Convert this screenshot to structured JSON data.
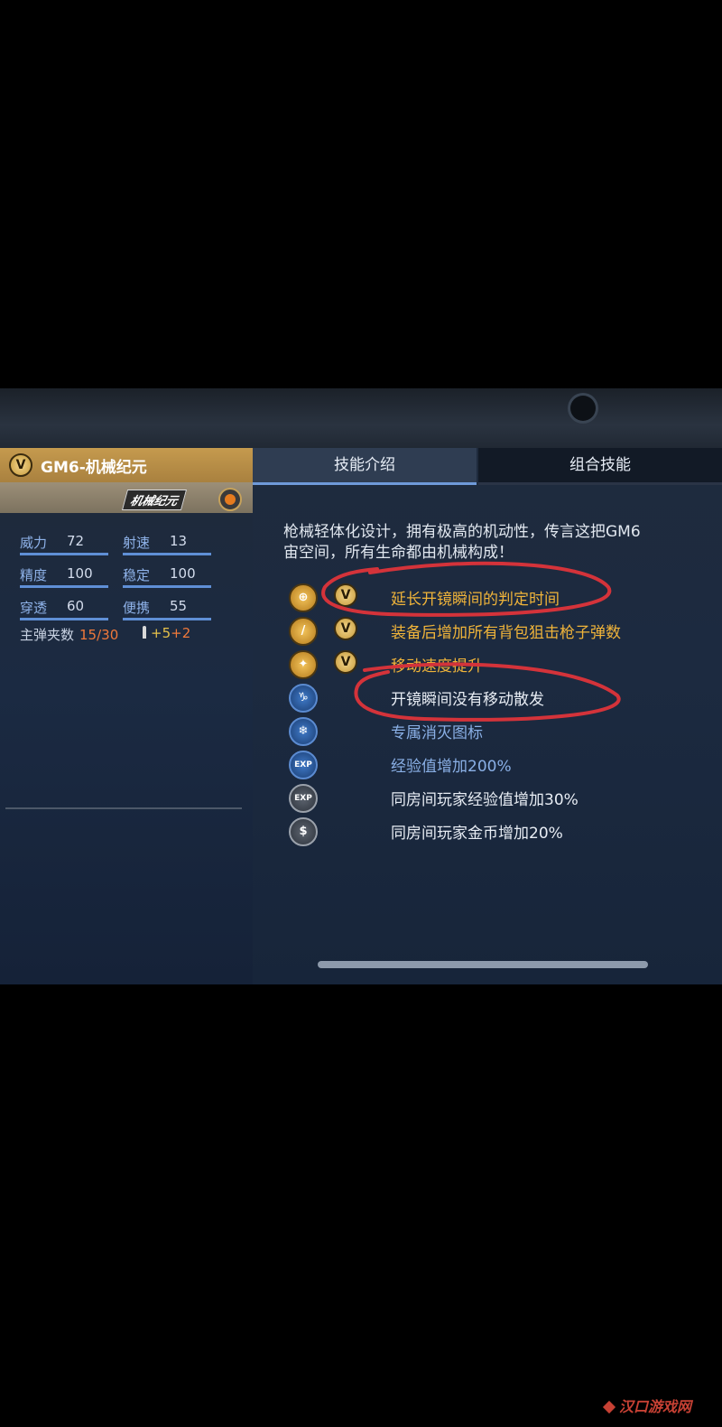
{
  "weapon": {
    "name": "GM6-机械纪元",
    "brand": "机械纪元",
    "v_label": "V"
  },
  "stats": [
    {
      "label": "威力",
      "value": "72",
      "level": 0.72
    },
    {
      "label": "射速",
      "value": "13",
      "level": 0.13
    },
    {
      "label": "精度",
      "value": "100",
      "level": 1.0
    },
    {
      "label": "稳定",
      "value": "100",
      "level": 1.0
    },
    {
      "label": "穿透",
      "value": "60",
      "level": 0.6
    },
    {
      "label": "便携",
      "value": "55",
      "level": 0.55
    }
  ],
  "magazine": {
    "label": "主弹夹数",
    "current": "15",
    "separator": "/",
    "max": "30",
    "bonus1": "+5",
    "bonus2": "+2"
  },
  "tabs": [
    "技能介绍",
    "组合技能"
  ],
  "description": "枪械轻体化设计，拥有极高的机动性，传言这把GM6\n宙空间，所有生命都由机械构成！",
  "skills": [
    {
      "icon": "crosshair-icon",
      "v": true,
      "text": "延长开镜瞬间的判定时间",
      "color": "orange"
    },
    {
      "icon": "sniper-bullet-icon",
      "v": true,
      "text": "装备后增加所有背包狙击枪子弹数",
      "color": "orange"
    },
    {
      "icon": "running-man-icon",
      "v": true,
      "text": "移动速度提升",
      "color": "orange"
    },
    {
      "icon": "capricorn-icon",
      "v": false,
      "text": "开镜瞬间没有移动散发",
      "color": "light"
    },
    {
      "icon": "snowflake-icon",
      "v": false,
      "text": "专属消灭图标",
      "color": "blue"
    },
    {
      "icon": "exp-icon",
      "v": false,
      "text": "经验值增加200%",
      "color": "blue"
    },
    {
      "icon": "exp-plus-icon",
      "v": false,
      "text": "同房间玩家经验值增加30%",
      "color": "light"
    },
    {
      "icon": "coin-icon",
      "v": false,
      "text": "同房间玩家金币增加20%",
      "color": "light"
    }
  ],
  "watermark": "汉口游戏网",
  "colors": {
    "title_gold": "#c59a4e",
    "stat_bar": "#5f8fd6",
    "skill_orange": "#f0b43a",
    "annotation_red": "#d4333a"
  }
}
